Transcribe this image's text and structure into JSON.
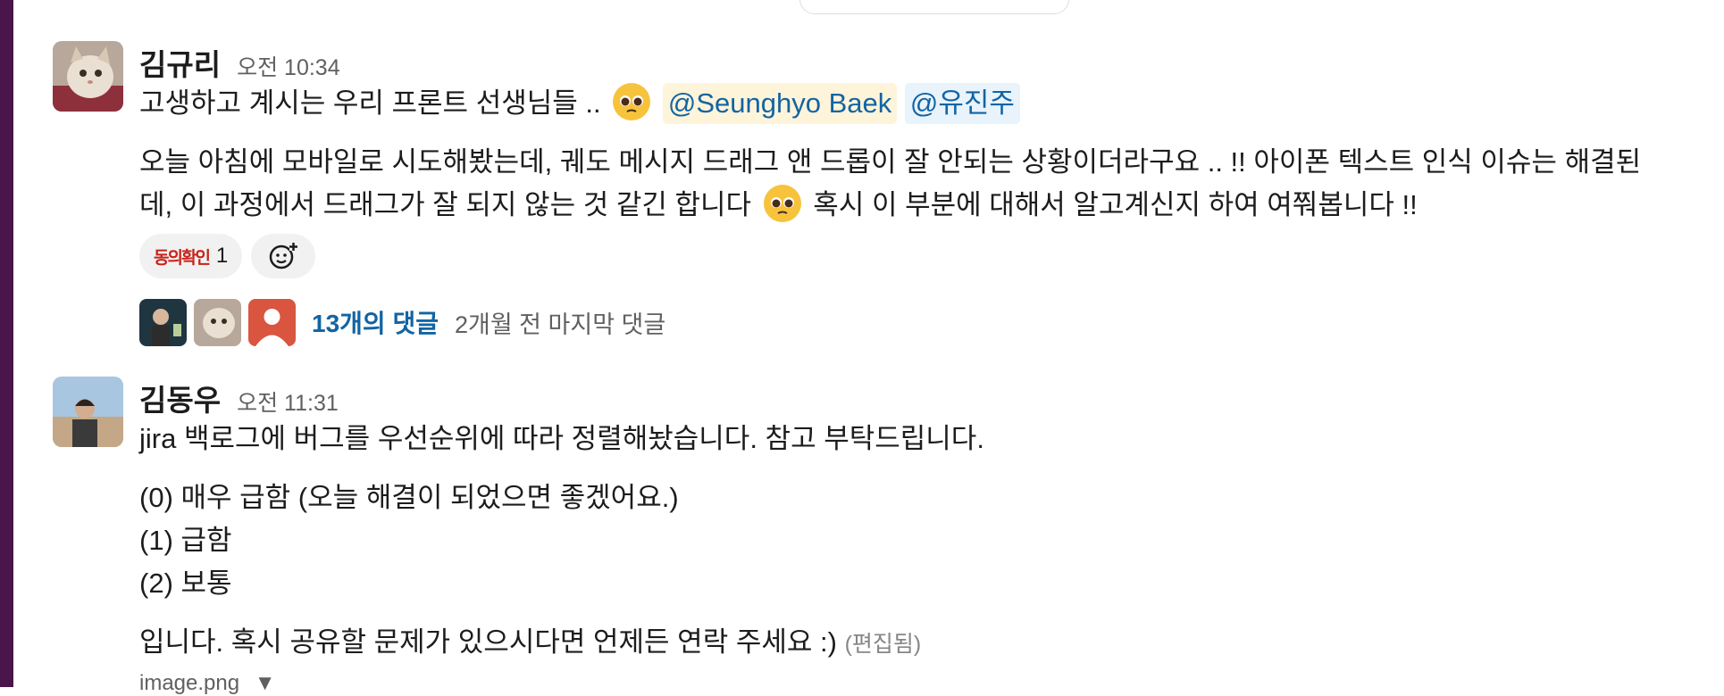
{
  "messages": [
    {
      "author": "김규리",
      "time": "오전 10:34",
      "line1_text": "고생하고 계시는 우리 프론트 선생님들 ..",
      "mentions": [
        "@Seunghyo Baek",
        "@유진주"
      ],
      "para1": "오늘 아침에 모바일로 시도해봤는데, 궤도 메시지 드래그 앤 드롭이 잘 안되는 상황이더라구요 .. !! 아이폰 텍스트 인식 이슈는 해결된",
      "para2a": "데, 이 과정에서 드래그가 잘 되지 않는 것 같긴 합니다",
      "para2b": "혹시 이 부분에 대해서 알고계신지 하여 여쭤봅니다 !!",
      "reaction": {
        "emoji_text": "동의확인",
        "count": "1"
      },
      "thread": {
        "count_label": "13개의 댓글",
        "last_reply": "2개월 전 마지막 댓글"
      }
    },
    {
      "author": "김동우",
      "time": "오전 11:31",
      "line1": "jira 백로그에 버그를 우선순위에 따라 정렬해놨습니다. 참고 부탁드립니다.",
      "list": [
        "(0) 매우 급함 (오늘 해결이 되었으면 좋겠어요.)",
        "(1) 급함",
        "(2) 보통"
      ],
      "closing": "입니다. 혹시 공유할 문제가 있으시다면 언제든 연락 주세요 :)",
      "edited": "(편집됨)",
      "attachment": "image.png"
    }
  ],
  "icons": {
    "pleading_face": "pleading-face-emoji",
    "add_reaction": "add-reaction-icon",
    "attachment_toggle": "caret-down-icon"
  },
  "colors": {
    "sidebar": "#4a154b",
    "link": "#1264a3",
    "mention_yellow": "#fdf4da",
    "mention_blue": "#e8f3fc"
  }
}
